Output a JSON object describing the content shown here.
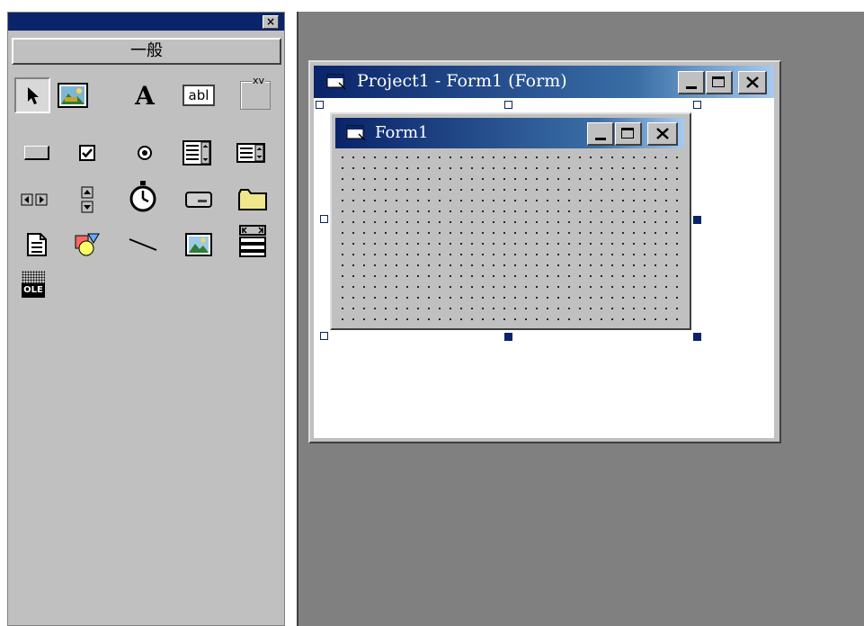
{
  "toolbox": {
    "close_glyph": "×",
    "tab_label": "一般",
    "tools": [
      {
        "icon": "pointer-icon"
      },
      {
        "icon": "picturebox-icon"
      },
      {
        "icon": "label-icon",
        "text": "A"
      },
      {
        "icon": "textbox-icon",
        "text": "abl"
      },
      {
        "icon": "frame-icon",
        "text": "xv"
      },
      {
        "icon": "commandbutton-icon"
      },
      {
        "icon": "checkbox-icon"
      },
      {
        "icon": "optionbutton-icon"
      },
      {
        "icon": "combobox-icon"
      },
      {
        "icon": "listbox-icon"
      },
      {
        "icon": "hscrollbar-icon"
      },
      {
        "icon": "vscrollbar-icon"
      },
      {
        "icon": "timer-icon"
      },
      {
        "icon": "drivelistbox-icon"
      },
      {
        "icon": "dirlistbox-icon"
      },
      {
        "icon": "filelistbox-icon"
      },
      {
        "icon": "shape-icon"
      },
      {
        "icon": "line-icon"
      },
      {
        "icon": "image-icon"
      },
      {
        "icon": "data-icon"
      },
      {
        "icon": "ole-icon",
        "text": "OLE"
      }
    ]
  },
  "designer": {
    "title": "Project1 - Form1 (Form)"
  },
  "form": {
    "title": "Form1"
  },
  "colors": {
    "titlebar_start": "#0a246a",
    "titlebar_end": "#a6caf0",
    "face": "#c0c0c0",
    "workspace": "#808080",
    "handle": "#0a246a"
  }
}
